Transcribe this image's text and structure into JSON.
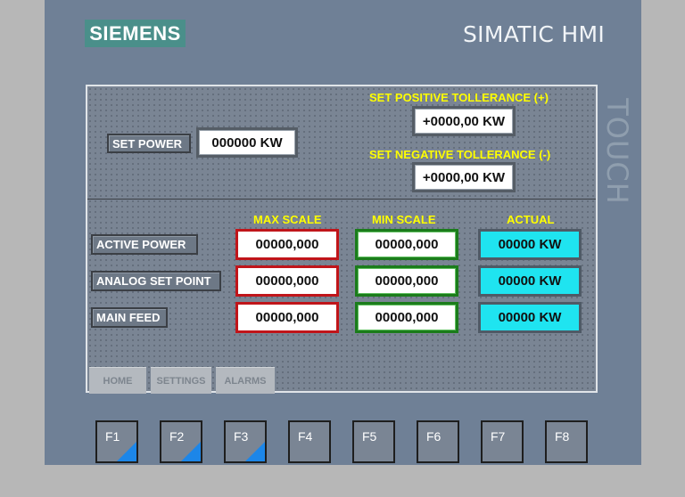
{
  "header": {
    "logo_text": "SIEMENS",
    "brand": "SIMATIC HMI",
    "side_label": "TOUCH"
  },
  "setpoints": {
    "set_power_label": "SET POWER",
    "set_power_value": "000000 KW",
    "pos_tol_label": "SET POSITIVE TOLLERANCE (+)",
    "pos_tol_value": "+0000,00 KW",
    "neg_tol_label": "SET NEGATIVE TOLLERANCE (-)",
    "neg_tol_value": "+0000,00 KW"
  },
  "table": {
    "headers": {
      "max": "MAX SCALE",
      "min": "MIN SCALE",
      "actual": "ACTUAL"
    },
    "rows": [
      {
        "label": "ACTIVE POWER",
        "max": "00000,000",
        "min": "00000,000",
        "actual": "00000 KW"
      },
      {
        "label": "ANALOG SET POINT",
        "max": "00000,000",
        "min": "00000,000",
        "actual": "00000 KW"
      },
      {
        "label": "MAIN FEED",
        "max": "00000,000",
        "min": "00000,000",
        "actual": "00000 KW"
      }
    ]
  },
  "nav_tabs": [
    "HOME",
    "SETTINGS",
    "ALARMS"
  ],
  "function_keys": [
    "F1",
    "F2",
    "F3",
    "F4",
    "F5",
    "F6",
    "F7",
    "F8"
  ],
  "colors": {
    "accent_yellow": "#ffff00",
    "actual_cyan": "#1fe4f0",
    "max_border_red": "#c0151a",
    "min_border_green": "#1b7c1b",
    "fkey_corner_blue": "#1c86e8"
  }
}
